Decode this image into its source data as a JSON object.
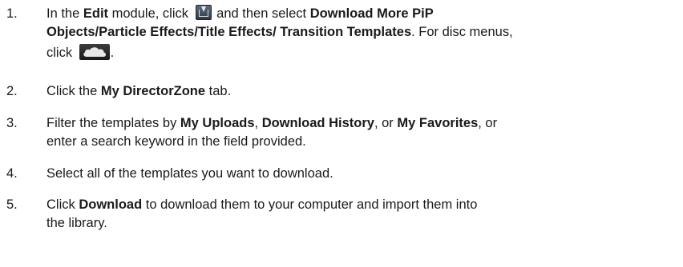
{
  "steps": [
    {
      "number": "1.",
      "t1": "In the ",
      "b1": "Edit",
      "t2": " module, click ",
      "t3": " and then select ",
      "b2": "Download More PiP",
      "b3": "Objects/Particle Effects/Title Effects/ Transition Templates",
      "t4": ". For disc menus,",
      "t5": "click ",
      "t6": "."
    },
    {
      "number": "2.",
      "t1": "Click the ",
      "b1": "My DirectorZone",
      "t2": " tab."
    },
    {
      "number": "3.",
      "t1": "Filter the templates by ",
      "b1": "My Uploads",
      "t2": ", ",
      "b2": "Download History",
      "t3": ", or ",
      "b3": "My Favorites",
      "t4": ", or",
      "t5": "enter a search keyword in the field provided."
    },
    {
      "number": "4.",
      "t1": "Select all of the templates you want to download."
    },
    {
      "number": "5.",
      "t1": "Click ",
      "b1": "Download",
      "t2": " to download them to your computer and import them into",
      "t3": "the library."
    }
  ],
  "icons": {
    "download_icon": "download-templates-icon",
    "cloud_icon": "cloud-icon"
  }
}
